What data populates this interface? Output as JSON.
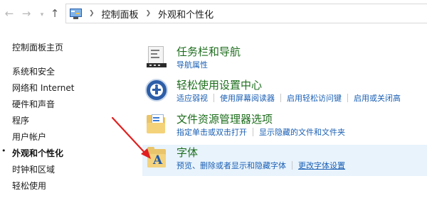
{
  "address": {
    "crumbs": [
      "控制面板",
      "外观和个性化"
    ]
  },
  "sidebar": {
    "items": [
      {
        "label": "控制面板主页",
        "active": false
      },
      {
        "label": "系统和安全",
        "active": false
      },
      {
        "label": "网络和 Internet",
        "active": false
      },
      {
        "label": "硬件和声音",
        "active": false
      },
      {
        "label": "程序",
        "active": false
      },
      {
        "label": "用户帐户",
        "active": false
      },
      {
        "label": "外观和个性化",
        "active": true
      },
      {
        "label": "时钟和区域",
        "active": false
      },
      {
        "label": "轻松使用",
        "active": false
      }
    ]
  },
  "categories": [
    {
      "title": "任务栏和导航",
      "links": [
        "导航属性"
      ],
      "icon": "taskbar-icon"
    },
    {
      "title": "轻松使用设置中心",
      "links": [
        "适应弱视",
        "使用屏幕阅读器",
        "启用轻松访问键",
        "启用或关闭高"
      ],
      "icon": "ease-of-access-icon"
    },
    {
      "title": "文件资源管理器选项",
      "links": [
        "指定单击或双击打开",
        "显示隐藏的文件和文件夹"
      ],
      "icon": "folder-options-icon"
    },
    {
      "title": "字体",
      "links": [
        "预览、删除或者显示和隐藏字体",
        "更改字体设置"
      ],
      "icon": "fonts-folder-icon"
    }
  ],
  "colors": {
    "title_green": "#1e6e1e",
    "link_blue": "#1a5fb4",
    "selected_bg": "#e8f3fc",
    "arrow_red": "#e02020"
  }
}
